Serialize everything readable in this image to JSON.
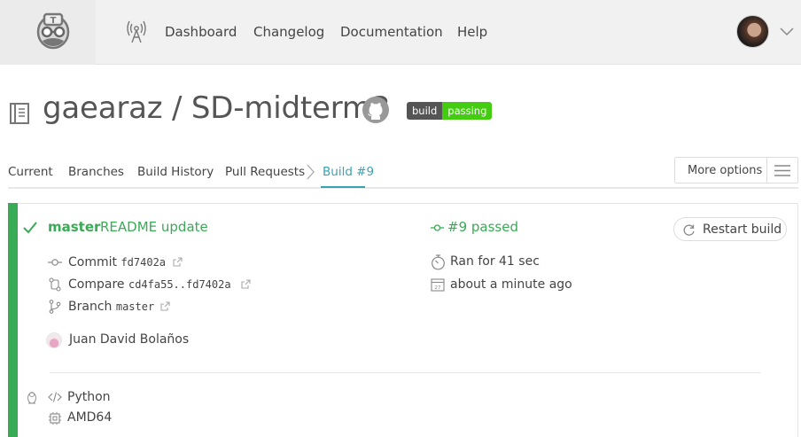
{
  "nav": {
    "links": [
      "Dashboard",
      "Changelog",
      "Documentation",
      "Help"
    ],
    "logo_icon": "travis-mascot-icon",
    "broadcast_icon": "broadcast-tower-icon",
    "menu_icon": "chevron-down-icon"
  },
  "repo": {
    "title": "gaearaz / SD-midterm3",
    "badge_label": "build",
    "badge_status": "passing",
    "badge_color": "#44cc11"
  },
  "tabs": {
    "current": "Current",
    "branches": "Branches",
    "history": "Build History",
    "pull_requests": "Pull Requests",
    "build": "Build #9",
    "more_options": "More options"
  },
  "build": {
    "branch": "master",
    "message": "README update",
    "number_status": "#9 passed",
    "restart": "Restart build",
    "commit_label": "Commit",
    "commit_sha": "fd7402a",
    "compare_label": "Compare",
    "compare_range": "cd4fa55..fd7402a",
    "branch_label": "Branch",
    "branch_value": "master",
    "ran_for": "Ran for 41 sec",
    "finished": "about a minute ago",
    "author": "Juan David Bolaños",
    "language": "Python",
    "arch": "AMD64",
    "status_color": "#39aa56"
  }
}
